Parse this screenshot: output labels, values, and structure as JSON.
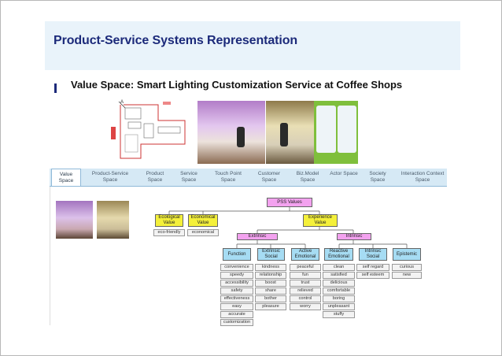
{
  "title": "Product-Service Systems Representation",
  "subtitle": "Value Space: Smart Lighting Customization Service at Coffee Shops",
  "tabs": [
    {
      "label": "Value Space",
      "active": true
    },
    {
      "label": "Product-Service Space",
      "active": false
    },
    {
      "label": "Product Space",
      "active": false
    },
    {
      "label": "Service Space",
      "active": false
    },
    {
      "label": "Touch Point Space",
      "active": false
    },
    {
      "label": "Customer Space",
      "active": false
    },
    {
      "label": "Biz.Model Space",
      "active": false
    },
    {
      "label": "Actor Space",
      "active": false
    },
    {
      "label": "Society Space",
      "active": false
    },
    {
      "label": "Interaction Context Space",
      "active": false
    }
  ],
  "tree": {
    "root": "PSS Values",
    "ecological": "Ecological Value",
    "economical": "Economical Value",
    "experience": "Experience Value",
    "extrinsic": "Extrinsic",
    "intrinsic": "Intrinsic",
    "eco_leaf": "eco-friendly",
    "econ_leaf": "economical",
    "categories": [
      {
        "label": "Function",
        "leaves": [
          "convenience",
          "speedy",
          "accessibility",
          "safety",
          "effectiveness",
          "easy",
          "accurate",
          "customization"
        ]
      },
      {
        "label": "Extrinsic Social",
        "leaves": [
          "kindness",
          "relationship",
          "boost",
          "share",
          "bother",
          "pleasure"
        ]
      },
      {
        "label": "Active Emotional",
        "leaves": [
          "peaceful",
          "fun",
          "trust",
          "relieved",
          "control",
          "worry"
        ]
      },
      {
        "label": "Reactive Emotional",
        "leaves": [
          "clean",
          "satisfied",
          "delicious",
          "comfortable",
          "boring",
          "unpleasant",
          "stuffy"
        ]
      },
      {
        "label": "Intrinsic Social",
        "leaves": [
          "self regard",
          "self esteem"
        ]
      },
      {
        "label": "Epistemic",
        "leaves": [
          "curious",
          "new"
        ]
      }
    ]
  },
  "colors": {
    "title": "#1c2a7a",
    "title_band": "#e9f3fa",
    "pink": "#f3a2ef",
    "yellow": "#f4f03a",
    "cyan": "#a6dcf3"
  }
}
